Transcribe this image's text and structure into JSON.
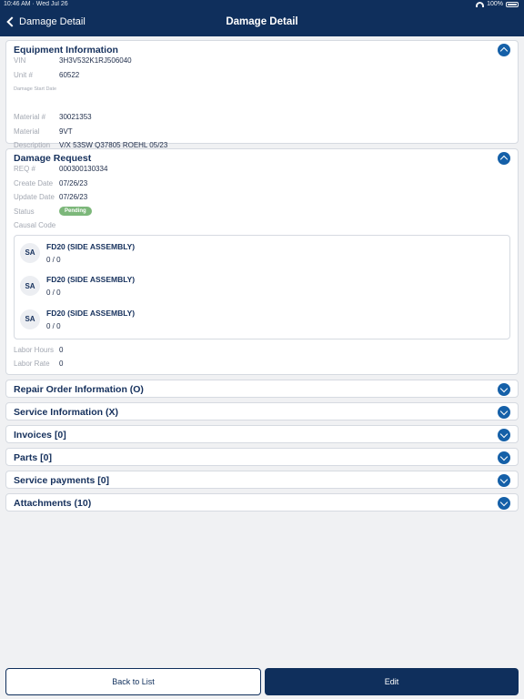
{
  "status_bar": {
    "time": "10:46 AM · Wed Jul 26",
    "battery": "100%"
  },
  "nav": {
    "back_label": "Damage Detail",
    "title": "Damage Detail"
  },
  "equipment": {
    "title": "Equipment Information",
    "vin_label": "VIN",
    "vin": "3H3V532K1RJ506040",
    "unit_label": "Unit #",
    "unit": "60522",
    "damage_date_label": "Damage Start Date",
    "material_num_label": "Material #",
    "material_num": "30021353",
    "material_label": "Material",
    "material": "9VT",
    "description_label": "Description",
    "description": "V/X 53SW Q37805 ROEHL 05/23"
  },
  "damage_request": {
    "title": "Damage Request",
    "req_label": "REQ #",
    "req": "000300130334",
    "create_label": "Create Date",
    "create": "07/26/23",
    "update_label": "Update Date",
    "update": "07/26/23",
    "status_label": "Status",
    "status": "Pending",
    "causal_label": "Causal Code",
    "causal_items": [
      {
        "initials": "SA",
        "title": "FD20 (SIDE ASSEMBLY)",
        "count": "0 / 0"
      },
      {
        "initials": "SA",
        "title": "FD20 (SIDE ASSEMBLY)",
        "count": "0 / 0"
      },
      {
        "initials": "SA",
        "title": "FD20 (SIDE ASSEMBLY)",
        "count": "0 / 0"
      }
    ],
    "labor_hours_label": "Labor Hours",
    "labor_hours": "0",
    "labor_rate_label": "Labor Rate",
    "labor_rate": "0"
  },
  "sections": [
    {
      "title": "Repair Order Information (O)"
    },
    {
      "title": "Service Information (X)"
    },
    {
      "title": "Invoices [0]"
    },
    {
      "title": "Parts [0]"
    },
    {
      "title": "Service payments [0]"
    },
    {
      "title": "Attachments (10)"
    }
  ],
  "footer": {
    "back_label": "Back to List",
    "edit_label": "Edit"
  },
  "colors": {
    "nav": "#0f2f5c",
    "accent": "#1560a8",
    "pending": "#7cb77a"
  }
}
